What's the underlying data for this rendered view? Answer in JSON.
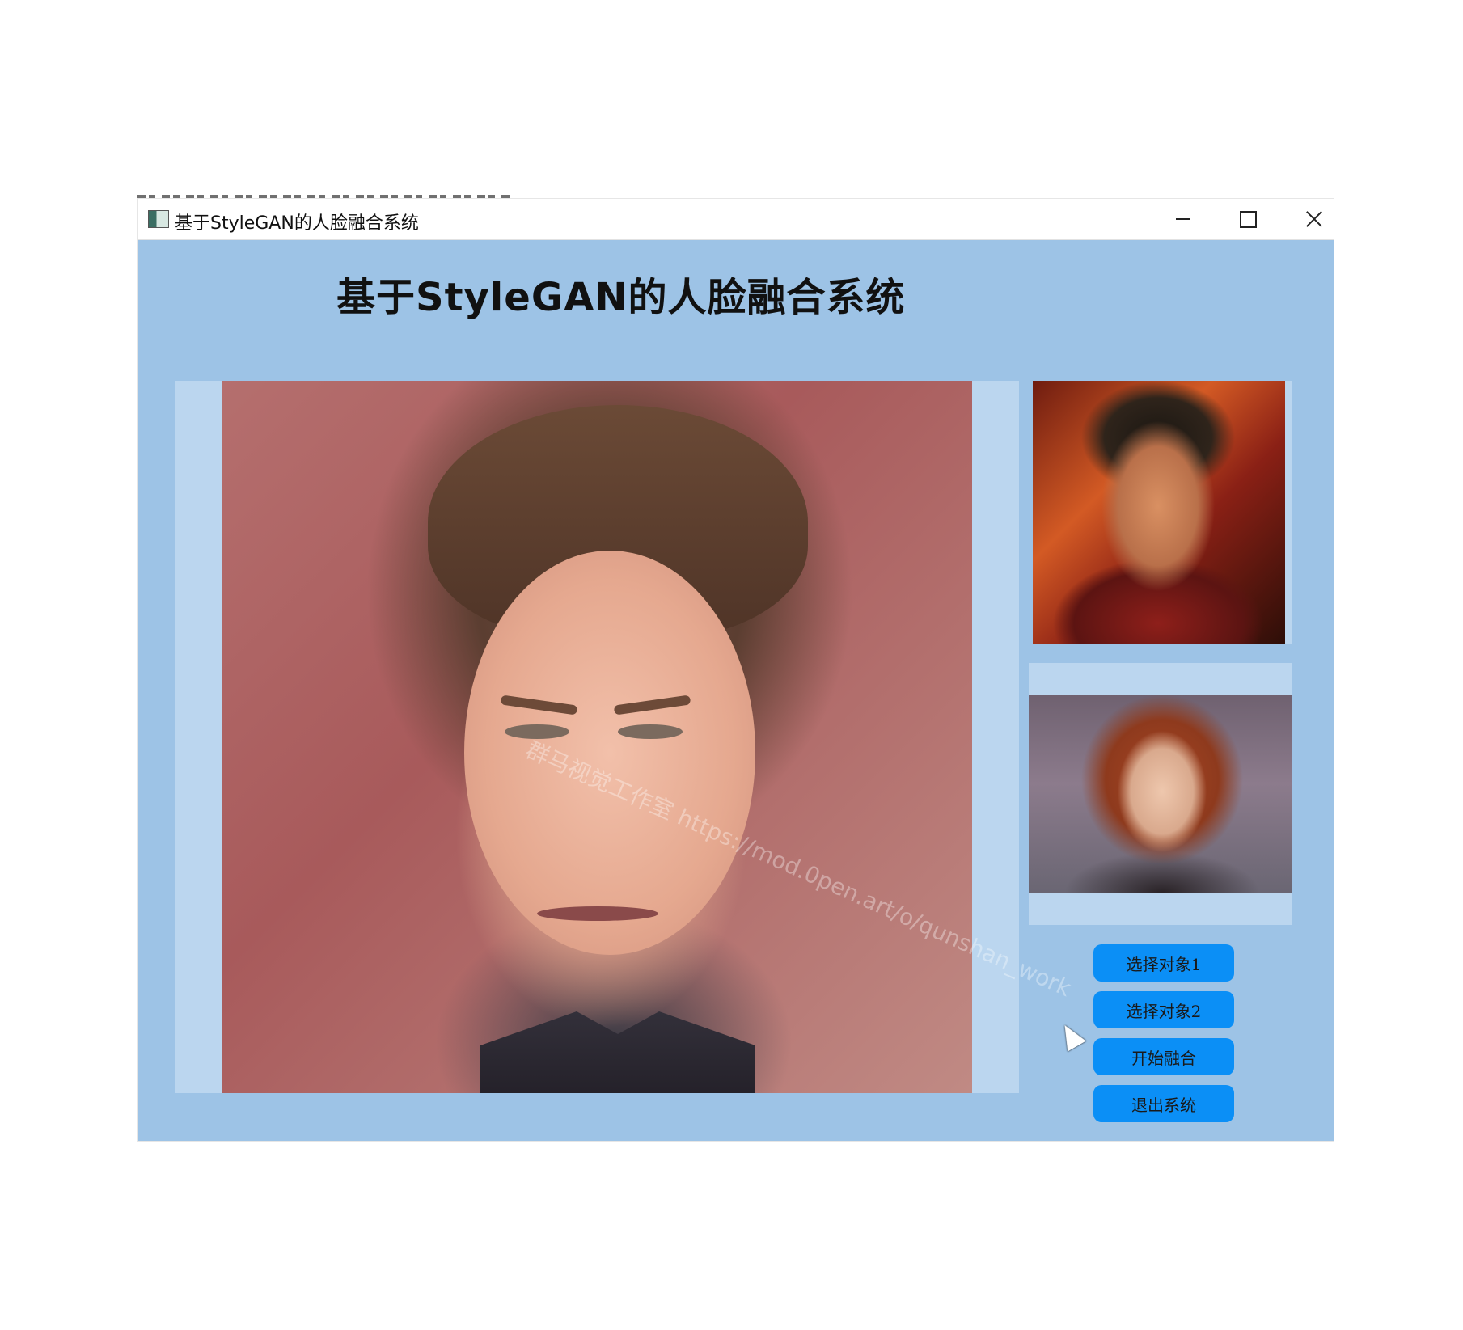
{
  "window": {
    "title": "基于StyleGAN的人脸融合系统"
  },
  "header": {
    "title": "基于StyleGAN的人脸融合系统"
  },
  "images": {
    "result": "fused-face-image",
    "object1": "object-1-face-image",
    "object2": "object-2-face-image"
  },
  "watermark": {
    "text": "群马视觉工作室  https://mod.0pen.art/o/qunshan_work"
  },
  "buttons": {
    "select1": "选择对象1",
    "select2": "选择对象2",
    "start": "开始融合",
    "exit": "退出系统"
  },
  "colors": {
    "window_bg": "#9dc3e6",
    "panel_bg": "#bbd6ef",
    "button_bg": "#0b8ff6"
  }
}
